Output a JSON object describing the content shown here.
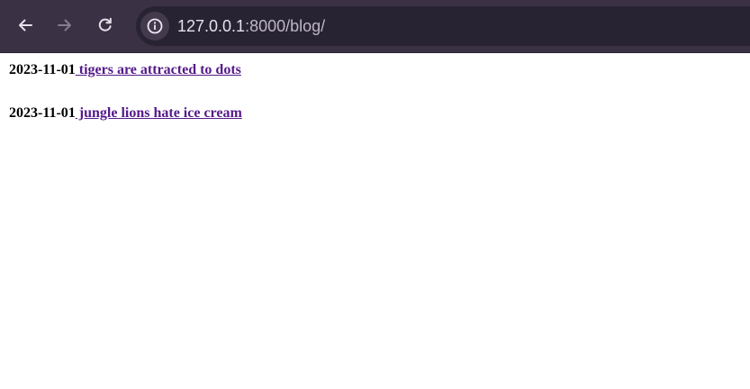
{
  "browser": {
    "url_host": "127.0.0.1",
    "url_rest": ":8000/blog/",
    "back_icon": "arrow-left-icon",
    "forward_icon": "arrow-right-icon",
    "reload_icon": "reload-icon",
    "site_info_icon": "info-icon"
  },
  "posts": [
    {
      "date": "2023-11-01",
      "title": " tigers are attracted to dots"
    },
    {
      "date": "2023-11-01",
      "title": " jungle lions hate ice cream"
    }
  ],
  "colors": {
    "toolbar": "#3a3144",
    "omnibox": "#282333",
    "visited_link": "#551a8b"
  }
}
